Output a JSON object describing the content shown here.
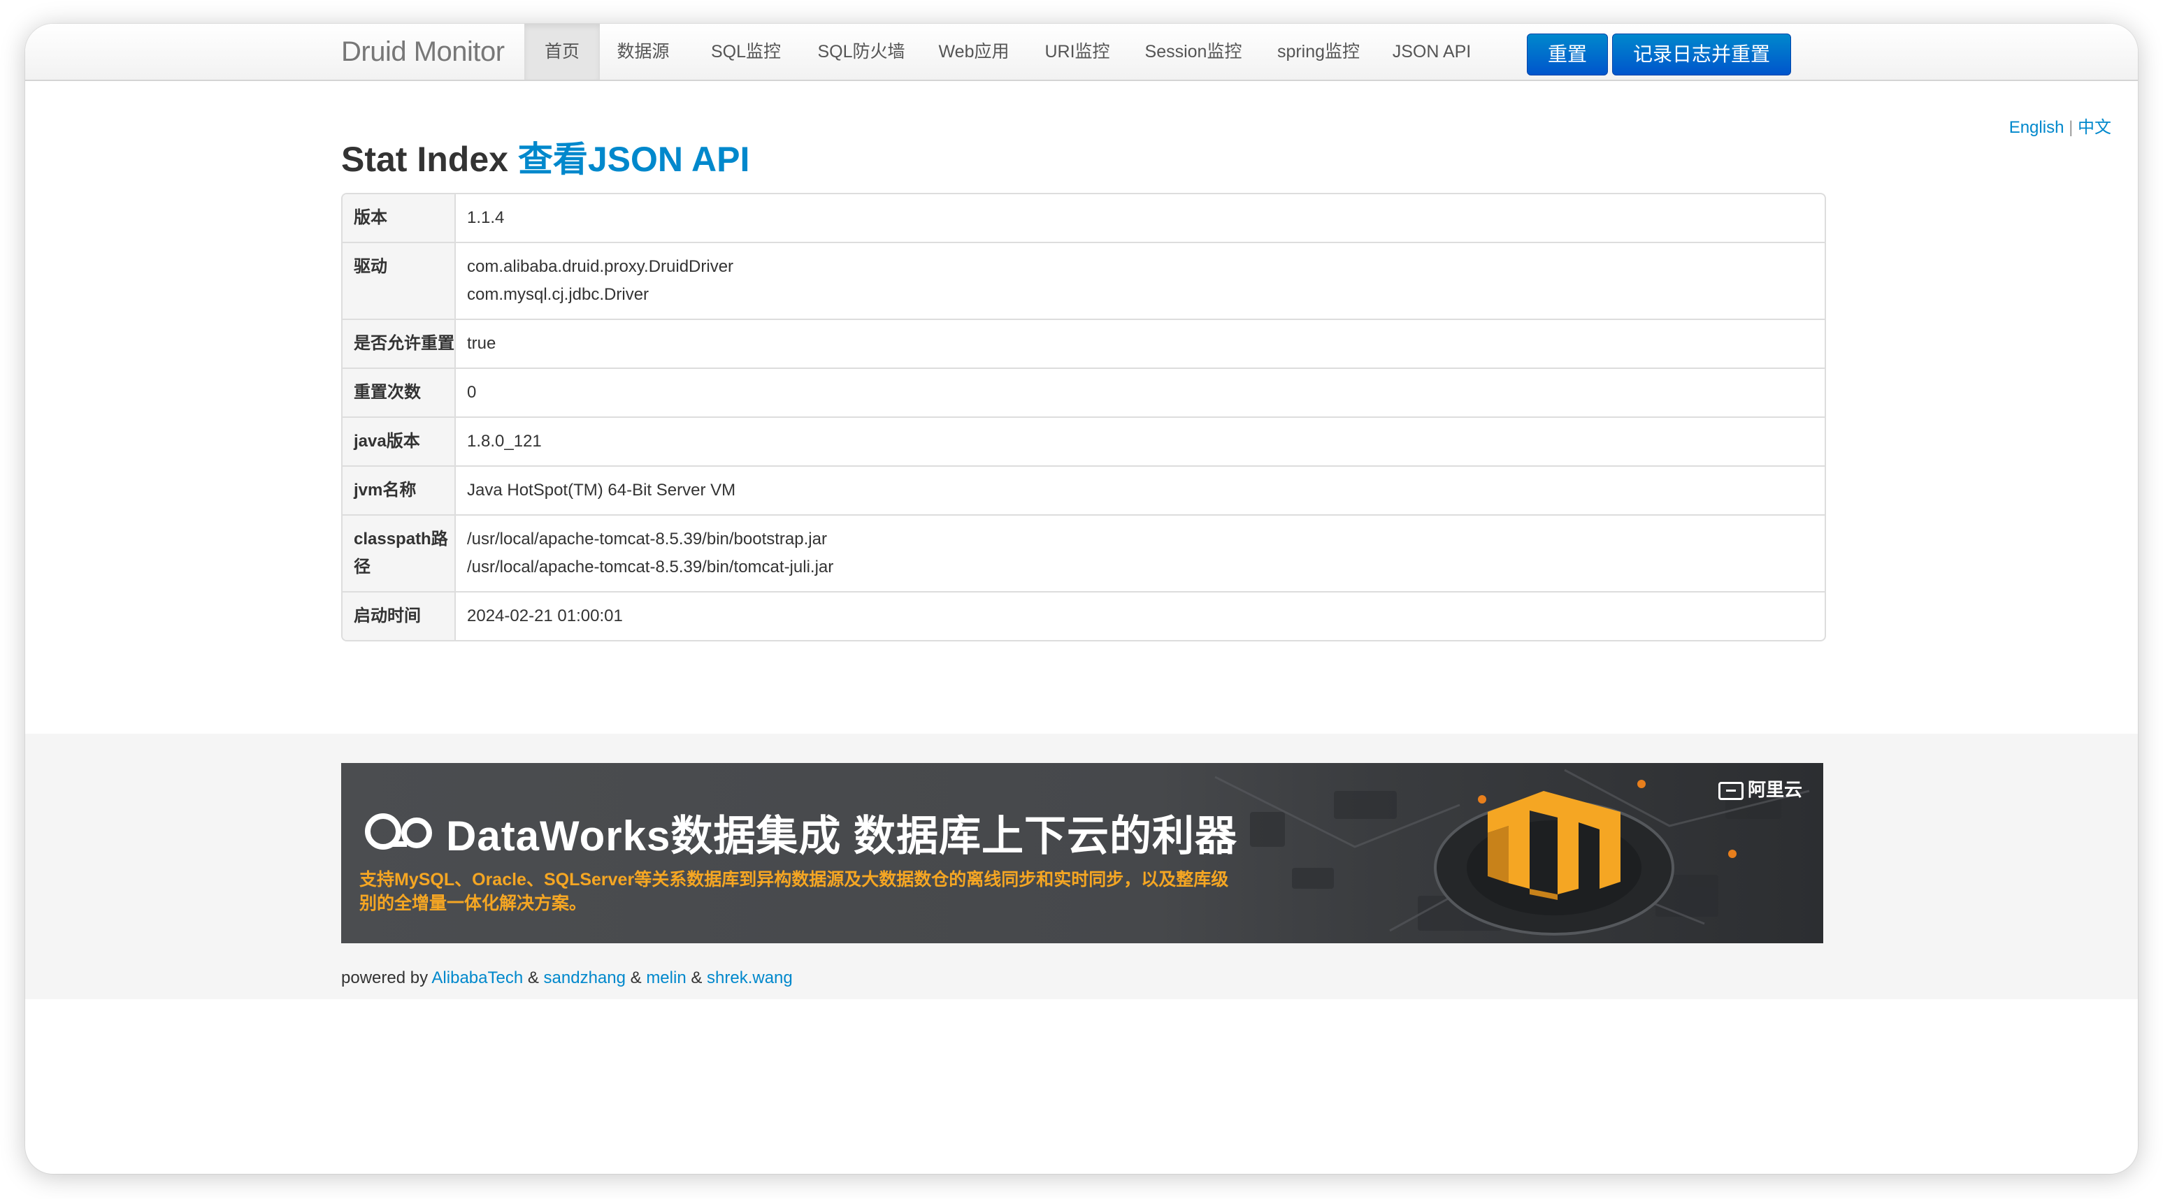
{
  "navbar": {
    "brand": "Druid Monitor",
    "items": [
      {
        "label": "首页",
        "active": true
      },
      {
        "label": "数据源"
      },
      {
        "label": "SQL监控"
      },
      {
        "label": "SQL防火墙"
      },
      {
        "label": "Web应用"
      },
      {
        "label": "URI监控"
      },
      {
        "label": "Session监控"
      },
      {
        "label": "spring监控"
      },
      {
        "label": "JSON API"
      }
    ],
    "reset_label": "重置",
    "log_reset_label": "记录日志并重置"
  },
  "lang": {
    "english": "English",
    "sep": "|",
    "chinese": "中文"
  },
  "title": {
    "prefix": "Stat Index ",
    "link": "查看JSON API"
  },
  "stats": [
    {
      "label": "版本",
      "values": [
        "1.1.4"
      ]
    },
    {
      "label": "驱动",
      "values": [
        "com.alibaba.druid.proxy.DruidDriver",
        "com.mysql.cj.jdbc.Driver"
      ]
    },
    {
      "label": "是否允许重置",
      "values": [
        "true"
      ]
    },
    {
      "label": "重置次数",
      "values": [
        "0"
      ]
    },
    {
      "label": "java版本",
      "values": [
        "1.8.0_121"
      ]
    },
    {
      "label": "jvm名称",
      "values": [
        "Java HotSpot(TM) 64-Bit Server VM"
      ]
    },
    {
      "label": "classpath路径",
      "values": [
        "/usr/local/apache-tomcat-8.5.39/bin/bootstrap.jar",
        "/usr/local/apache-tomcat-8.5.39/bin/tomcat-juli.jar"
      ]
    },
    {
      "label": "启动时间",
      "values": [
        "2024-02-21 01:00:01"
      ]
    }
  ],
  "banner": {
    "title": "DataWorks数据集成 数据库上下云的利器",
    "subtitle": "支持MySQL、Oracle、SQLServer等关系数据库到异构数据源及大数据数仓的离线同步和实时同步，以及整库级别的全增量一体化解决方案。",
    "aliyun": "阿里云",
    "accent": "#f5a623"
  },
  "footer": {
    "powered_by": "powered by ",
    "links": [
      "AlibabaTech",
      "sandzhang",
      "melin",
      "shrek.wang"
    ],
    "amp": " & "
  }
}
